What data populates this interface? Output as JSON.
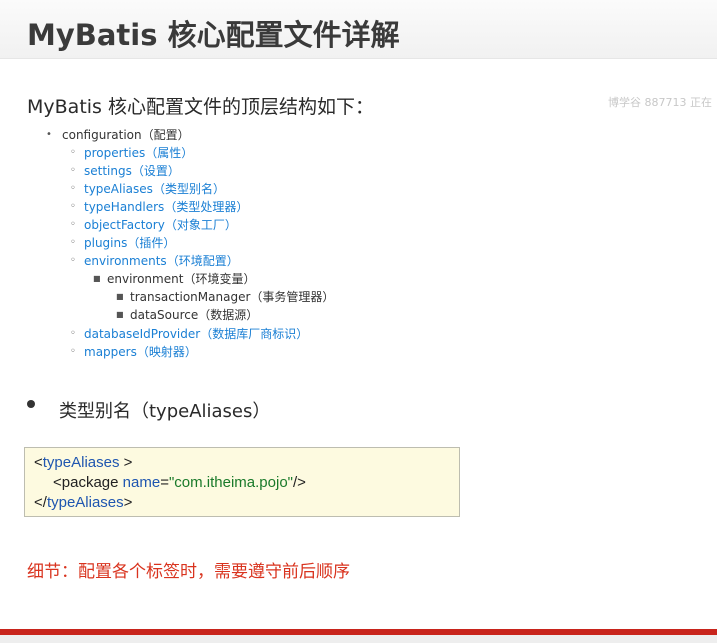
{
  "header": {
    "title": "MyBatis 核心配置文件详解"
  },
  "watermark": "博学谷 887713 正在",
  "subtitle": "MyBatis 核心配置文件的顶层结构如下：",
  "tree": {
    "root": {
      "name": "configuration",
      "note": "（配置）"
    },
    "children": [
      {
        "name": "properties",
        "note": "（属性）"
      },
      {
        "name": "settings",
        "note": "（设置）"
      },
      {
        "name": "typeAliases",
        "note": "（类型别名）"
      },
      {
        "name": "typeHandlers",
        "note": "（类型处理器）"
      },
      {
        "name": "objectFactory",
        "note": "（对象工厂）"
      },
      {
        "name": "plugins",
        "note": "（插件）"
      },
      {
        "name": "environments",
        "note": "（环境配置）"
      },
      {
        "name": "environment",
        "note": "（环境变量）"
      },
      {
        "name": "transactionManager",
        "note": "（事务管理器）"
      },
      {
        "name": "dataSource",
        "note": "（数据源）"
      },
      {
        "name": "databaseIdProvider",
        "note": "（数据库厂商标识）"
      },
      {
        "name": "mappers",
        "note": "（映射器）"
      }
    ]
  },
  "section": {
    "heading": "类型别名（typeAliases）"
  },
  "code": {
    "line1_open": "<",
    "line1_tag": "typeAliases",
    "line1_close": " >",
    "line2_open": "<",
    "line2_tag": "package",
    "line2_space": " ",
    "line2_attr": "name",
    "line2_eq": "=",
    "line2_val": "\"com.itheima.pojo\"",
    "line2_close": "/>",
    "line3_open": "</",
    "line3_tag": "typeAliases",
    "line3_close": ">"
  },
  "note": "细节：配置各个标签时，需要遵守前后顺序",
  "colors": {
    "accent_red": "#c8241c",
    "link_blue": "#1a7fd4",
    "note_red": "#d9331e"
  }
}
